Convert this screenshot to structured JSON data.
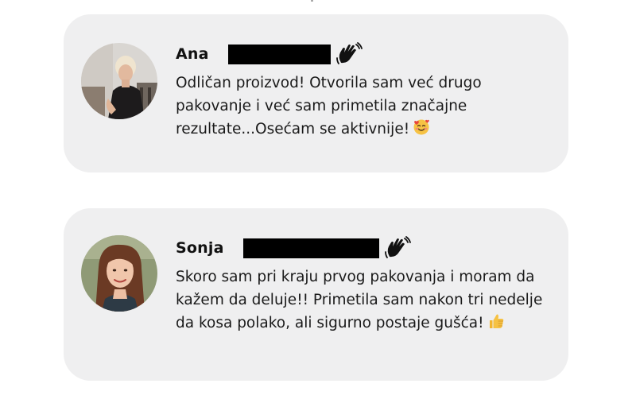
{
  "colors": {
    "card_background": "#efeff0",
    "text": "#1a1a1a",
    "redaction": "#000000",
    "emoji_face": "#f6c244",
    "emoji_heart": "#e8453c"
  },
  "reviews": [
    {
      "name": "Ana",
      "text": "Odličan proizvod! Otvorila sam već drugo pakovanje i već sam primetila značajne rezultate...Osećam se aktivnije!",
      "name_icon": "waving-hand-icon",
      "trailing_emoji": "smiling-face-with-hearts-icon"
    },
    {
      "name": "Sonja",
      "text": "Skoro sam pri kraju prvog pakovanja i moram da kažem da deluje!! Primetila sam nakon tri nedelje da kosa polako, ali sigurno postaje gušća!",
      "name_icon": "waving-hand-icon",
      "trailing_emoji": "thumbs-up-icon"
    }
  ]
}
